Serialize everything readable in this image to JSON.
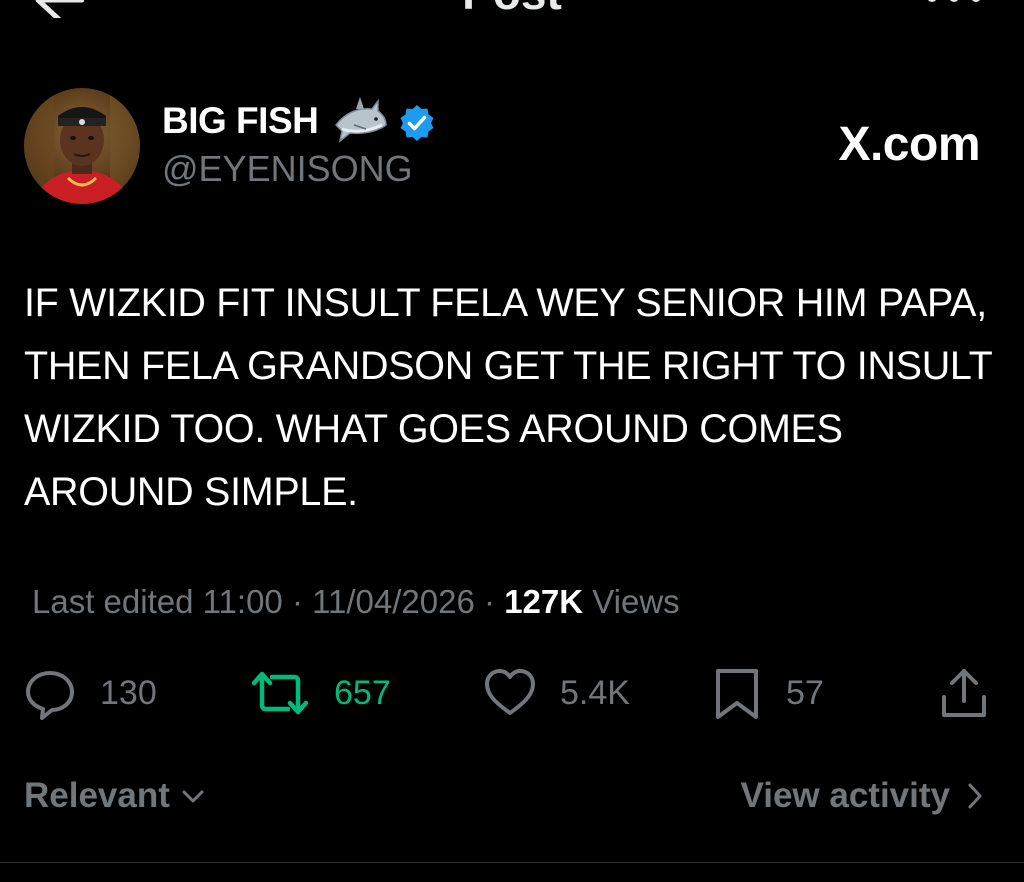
{
  "header": {
    "title": "Post"
  },
  "author": {
    "display_name": "BIG FISH",
    "handle": "@EYENISONG",
    "verified": true,
    "emoji": "shark",
    "verified_color": "#1d9bf0"
  },
  "brand": {
    "watermark": "X.com"
  },
  "post": {
    "text": "IF WIZKID FIT INSULT FELA WEY SENIOR HIM PAPA, THEN FELA GRANDSON GET THE RIGHT TO INSULT WIZKID TOO. WHAT GOES AROUND COMES AROUND SIMPLE.",
    "edited_label": "Last edited",
    "time": "11:00",
    "date": "11/04/2026",
    "views_count": "127K",
    "views_label": "Views"
  },
  "actions": {
    "replies": "130",
    "reposts": "657",
    "likes": "5.4K",
    "bookmarks": "57",
    "repost_color": "#00ba7c"
  },
  "footer": {
    "sort_label": "Relevant",
    "activity_label": "View activity"
  }
}
